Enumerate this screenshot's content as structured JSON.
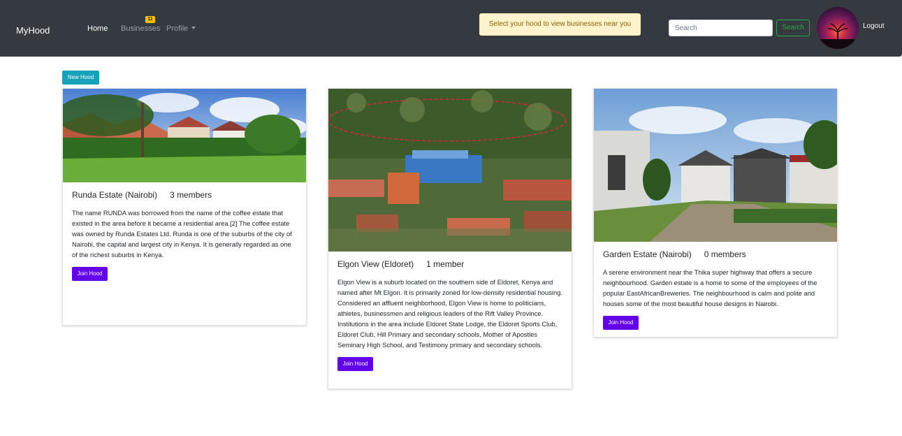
{
  "navbar": {
    "brand": "MyHood",
    "links": {
      "home": "Home",
      "businesses": "Businesses",
      "profile": "Profile"
    },
    "businesses_badge": "11",
    "alert": "Select your hood to view businesses near you",
    "search": {
      "placeholder": "Search",
      "button": "Search"
    },
    "logout": "Logout"
  },
  "new_hood_button": "New Hood",
  "hoods": [
    {
      "name": "Runda Estate (Nairobi)",
      "members": "3 members",
      "description": "The name RUNDA was borrowed from the name of the coffee estate that existed in the area before it became a residential area.[2] The coffee estate was owned by Runda Estates Ltd. Runda is one of the suburbs of the city of Nairobi, the capital and largest city in Kenya. It is generally regarded as one of the richest suburbs in Kenya.",
      "button": "Join Hood"
    },
    {
      "name": "Elgon View (Eldoret)",
      "members": "1 member",
      "description": "Elgon View is a suburb located on the southern side of Eldoret, Kenya and named after Mt Elgon. It is primarily zoned for low-density residential housing. Considered an affluent neighborhood, Elgon View is home to politicians, athletes, businessmen and religious leaders of the Rift Valley Province. Institutions in the area include Eldoret State Lodge, the Eldoret Sports Club, Eldoret Club, Hill Primary and secondary schools, Mother of Apostles Seminary High School, and Testimony primary and secondary schools.",
      "button": "Join Hood"
    },
    {
      "name": "Garden Estate (Nairobi)",
      "members": "0 members",
      "description": "A serene environment near the Thika super highway that offers a secure neighbourhood. Garden estate is a home to some of the employees of the popular EastAfricanBreweries. The neighbourhood is calm and polite and houses some of the most beautiful house designs in Nairobi.",
      "button": "Join Hood"
    }
  ],
  "colors": {
    "navbar": "#343a40",
    "alert_bg": "#fff3cd",
    "badge": "#ffc107",
    "success": "#28a745",
    "info": "#17a2b8",
    "join_button": "#6200ea"
  }
}
